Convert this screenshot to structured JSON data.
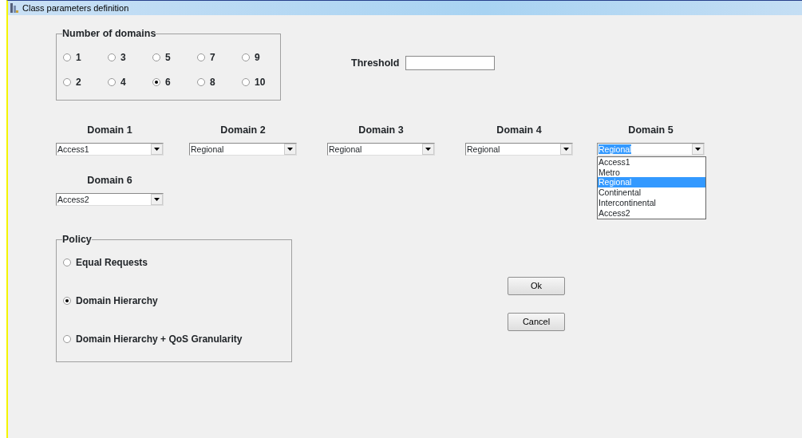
{
  "window": {
    "title": "Class parameters definition"
  },
  "number_of_domains": {
    "label": "Number of domains",
    "options": [
      {
        "label": "1",
        "selected": false
      },
      {
        "label": "2",
        "selected": false
      },
      {
        "label": "3",
        "selected": false
      },
      {
        "label": "4",
        "selected": false
      },
      {
        "label": "5",
        "selected": false
      },
      {
        "label": "6",
        "selected": true
      },
      {
        "label": "7",
        "selected": false
      },
      {
        "label": "8",
        "selected": false
      },
      {
        "label": "9",
        "selected": false
      },
      {
        "label": "10",
        "selected": false
      }
    ]
  },
  "threshold": {
    "label": "Threshold"
  },
  "domains": [
    {
      "label": "Domain 1",
      "value": "Access1",
      "expanded": false
    },
    {
      "label": "Domain 2",
      "value": "Regional",
      "expanded": false
    },
    {
      "label": "Domain 3",
      "value": "Regional",
      "expanded": false
    },
    {
      "label": "Domain 4",
      "value": "Regional",
      "expanded": false
    },
    {
      "label": "Domain 5",
      "value": "Regional",
      "expanded": true,
      "options": [
        {
          "label": "Access1",
          "selected": false
        },
        {
          "label": "Metro",
          "selected": false
        },
        {
          "label": "Regional",
          "selected": true
        },
        {
          "label": "Continental",
          "selected": false
        },
        {
          "label": "Intercontinental",
          "selected": false
        },
        {
          "label": "Access2",
          "selected": false
        }
      ]
    },
    {
      "label": "Domain 6",
      "value": "Access2",
      "expanded": false
    }
  ],
  "policy": {
    "label": "Policy",
    "options": [
      {
        "label": "Equal Requests",
        "selected": false
      },
      {
        "label": "Domain Hierarchy",
        "selected": true
      },
      {
        "label": "Domain Hierarchy + QoS Granularity",
        "selected": false
      }
    ]
  },
  "buttons": [
    {
      "label": "Ok"
    },
    {
      "label": "Cancel"
    }
  ]
}
